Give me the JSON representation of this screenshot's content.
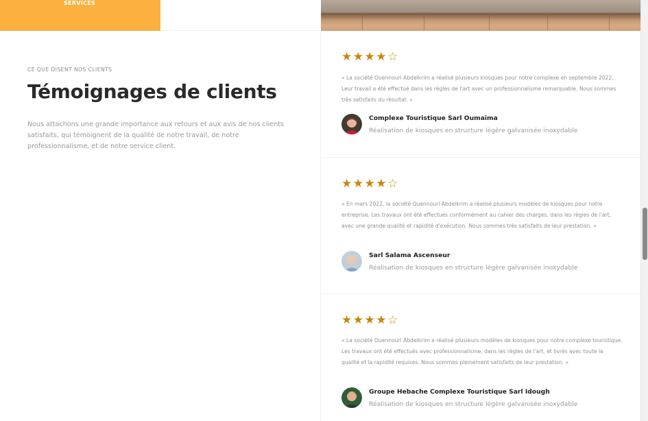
{
  "top_strip": {
    "services_label": "SERVICES"
  },
  "intro": {
    "eyebrow": "CE QUE DISENT NOS CLIENTS",
    "title": "Témoignages de clients",
    "description": "Nous attachons une grande importance aux retours et aux avis de nos clients satisfaits, qui témoignent de la qualité de notre travail, de notre professionnalisme, et de notre service client."
  },
  "testimonials": [
    {
      "stars": "★★★★☆",
      "rating": 4,
      "quote": "« La société Ouennouri Abdelkrim a réalisé plusieurs kiosques pour notre complexe en septembre 2022. Leur travail a été effectué dans les règles de l'art avec un professionnalisme remarquable. Nous sommes très satisfaits du résultat. »",
      "author": "Complexe Touristique Sarl Oumaima",
      "role": "Réalisation de kiosques en structure légère galvanisée inoxydable"
    },
    {
      "stars": "★★★★☆",
      "rating": 4,
      "quote": "« En mars 2022, la société Ouennouri Abdelkrim a réalisé plusieurs modèles de kiosques pour notre entreprise. Les travaux ont été effectués conformément au cahier des charges, dans les règles de l'art, avec une grande qualité et rapidité d'exécution. Nous sommes très satisfaits de leur prestation. »",
      "author": "Sarl Salama Ascenseur",
      "role": "Réalisation de kiosques en structure légère galvanisée inoxydable"
    },
    {
      "stars": "★★★★☆",
      "rating": 4,
      "quote": "« La société Ouennouri Abdelkrim a réalisé plusieurs modèles de kiosques pour notre complexe touristique. Les travaux ont été effectués avec professionnalisme, dans les règles de l'art, et livrés avec toute la qualité et la rapidité requises. Nous sommes pleinement satisfaits de leur prestation. »",
      "author": "Groupe Hebache Complexe Touristique Sarl Idough",
      "role": "Réalisation de kiosques en structure légère galvanisée inoxydable"
    }
  ],
  "colors": {
    "accent": "#fbb040",
    "star": "#c8860b"
  }
}
